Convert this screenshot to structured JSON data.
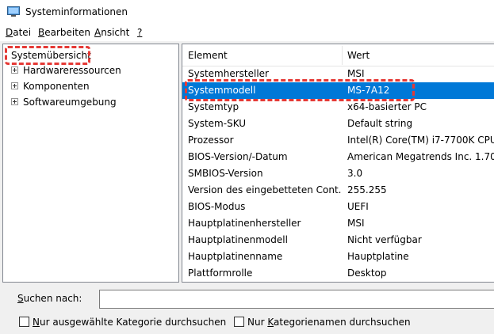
{
  "window": {
    "title": "Systeminformationen",
    "icon": "system-info-icon"
  },
  "menu": {
    "items": [
      {
        "underline": "D",
        "rest": "atei"
      },
      {
        "underline": "B",
        "rest": "earbeiten"
      },
      {
        "underline": "A",
        "rest": "nsicht"
      },
      {
        "underline": "?",
        "rest": ""
      }
    ]
  },
  "tree": {
    "root": "Systemübersicht",
    "children": [
      "Hardwareressourcen",
      "Komponenten",
      "Softwareumgebung"
    ]
  },
  "list": {
    "columns": [
      "Element",
      "Wert"
    ],
    "rows": [
      {
        "element": "Systemhersteller",
        "value": "MSI"
      },
      {
        "element": "Systemmodell",
        "value": "MS-7A12",
        "selected": true
      },
      {
        "element": "Systemtyp",
        "value": "x64-basierter PC"
      },
      {
        "element": "System-SKU",
        "value": "Default string"
      },
      {
        "element": "Prozessor",
        "value": "Intel(R) Core(TM) i7-7700K CPU"
      },
      {
        "element": "BIOS-Version/-Datum",
        "value": "American Megatrends Inc. 1.70,"
      },
      {
        "element": "SMBIOS-Version",
        "value": "3.0"
      },
      {
        "element": "Version des eingebetteten Cont...",
        "value": "255.255"
      },
      {
        "element": "BIOS-Modus",
        "value": "UEFI"
      },
      {
        "element": "Hauptplatinenhersteller",
        "value": "MSI"
      },
      {
        "element": "Hauptplatinenmodell",
        "value": "Nicht verfügbar"
      },
      {
        "element": "Hauptplatinenname",
        "value": "Hauptplatine"
      },
      {
        "element": "Plattformrolle",
        "value": "Desktop"
      }
    ]
  },
  "search": {
    "label_underline": "S",
    "label_rest": "uchen nach:",
    "value": "",
    "checkbox1": {
      "pre": "",
      "underline": "N",
      "post": "ur ausgewählte Kategorie durchsuchen",
      "checked": false
    },
    "checkbox2": {
      "pre": "Nur ",
      "underline": "K",
      "post": "ategorienamen durchsuchen",
      "checked": false
    }
  },
  "colors": {
    "selection": "#0078d7",
    "highlight_annotation": "#e53935"
  }
}
